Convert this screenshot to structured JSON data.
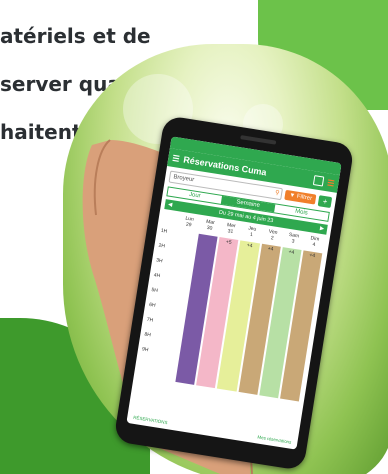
{
  "caption": {
    "lines": [
      "atériels et de",
      "server quand ils",
      "haitent."
    ],
    "corner_fragment": "c"
  },
  "colors": {
    "app_green": "#2fa84f",
    "filter_orange": "#f07f2a",
    "blob_light": "#6cc24a",
    "blob_dark": "#3e9a2c",
    "text_dark": "#2b2f33"
  },
  "phone_app": {
    "title": "Réservations Cuma",
    "search_value": "Broyeur",
    "filter_label": "Filtrer",
    "add_label": "+",
    "tabs": [
      "Jour",
      "Semaine",
      "Mois"
    ],
    "active_tab": "Semaine",
    "week_range": "Du 29 mai au 4 juin 23",
    "days": [
      {
        "name": "Lun",
        "num": "29"
      },
      {
        "name": "Mar",
        "num": "30"
      },
      {
        "name": "Mer",
        "num": "31"
      },
      {
        "name": "Jeu",
        "num": "1"
      },
      {
        "name": "Ven",
        "num": "2"
      },
      {
        "name": "Sam",
        "num": "3"
      },
      {
        "name": "Dim",
        "num": "4"
      }
    ],
    "hours": [
      "1H",
      "2H",
      "3H",
      "4H",
      "5H",
      "6H",
      "7H",
      "8H",
      "9H"
    ],
    "day_badges": [
      "",
      "",
      "+5",
      "+4",
      "+4",
      "+4",
      "+4"
    ],
    "column_colors": [
      "#ffffff",
      "#7b5aa6",
      "#f4b7c8",
      "#e6ef9a",
      "#c9a877",
      "#b7e0a5",
      "#c9a877"
    ],
    "footer_left": "RÉSERVATIONS",
    "footer_right": "Mes réservations"
  }
}
